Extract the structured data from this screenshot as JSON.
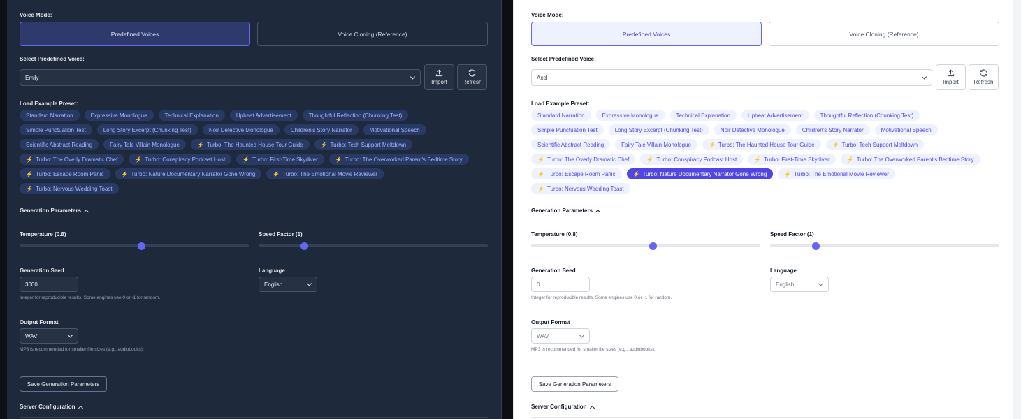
{
  "labels": {
    "voice_mode": "Voice Mode:",
    "select_voice": "Select Predefined Voice:",
    "load_preset": "Load Example Preset:",
    "gen_params": "Generation Parameters",
    "temperature": "Temperature (0.8)",
    "speed": "Speed Factor (1)",
    "seed": "Generation Seed",
    "language": "Language",
    "seed_help": "Integer for reproducible results. Some engines use 0 or -1 for random.",
    "output_format": "Output Format",
    "format_help": "MP3 is recommended for smaller file sizes (e.g., audiobooks).",
    "save_params": "Save Generation Parameters",
    "server_config": "Server Configuration"
  },
  "buttons": {
    "predefined": "Predefined Voices",
    "cloning": "Voice Cloning (Reference)",
    "import": "Import",
    "refresh": "Refresh"
  },
  "presets": [
    [
      "Standard Narration",
      "Expressive Monologue",
      "Technical Explanation",
      "Upbeat Advertisement",
      "Thoughtful Reflection (Chunking Test)"
    ],
    [
      "Simple Punctuation Test",
      "Long Story Excerpt (Chunking Test)",
      "Noir Detective Monologue",
      "Children's Story Narrator",
      "Motivational Speech"
    ],
    [
      "Scientific Abstract Reading",
      "Fairy Tale Villain Monologue",
      "Turbo: The Haunted House Tour Guide",
      "Turbo: Tech Support Meltdown"
    ],
    [
      "Turbo: The Overly Dramatic Chef",
      "Turbo: Conspiracy Podcast Host",
      "Turbo: First-Time Skydiver",
      "Turbo: The Overworked Parent's Bedtime Story"
    ],
    [
      "Turbo: Escape Room Panic",
      "Turbo: Nature Documentary Narrator Gone Wrong",
      "Turbo: The Emotional Movie Reviewer"
    ],
    [
      "Turbo: Nervous Wedding Toast"
    ]
  ],
  "dark": {
    "voice": "Emily",
    "temperature": 0.8,
    "speed": 1,
    "seed": "3000",
    "language": "English",
    "format": "WAV",
    "active_preset": ""
  },
  "light": {
    "voice": "Axel",
    "temperature": 0.8,
    "speed": 1,
    "seed": "0",
    "language": "English",
    "format": "WAV",
    "active_preset": "Turbo: Nature Documentary Narrator Gone Wrong"
  },
  "colors": {
    "accent": "#6366f1",
    "dark_bg": "#1e293b",
    "light_bg": "#ffffff"
  },
  "icons": {
    "import": "upload-icon",
    "refresh": "refresh-icon",
    "turbo": "lightning-bolt-icon"
  }
}
